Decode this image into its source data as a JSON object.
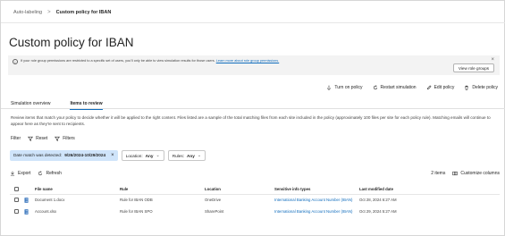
{
  "breadcrumb": {
    "parent": "Auto-labeling",
    "separator": ">",
    "current": "Custom policy for IBAN"
  },
  "page": {
    "title": "Custom policy for IBAN"
  },
  "banner": {
    "text": "If your role group permissions are restricted to a specific set of users, you'll only be able to view simulation results for those users.",
    "link": "Learn more about role group permissions.",
    "button": "View role groups",
    "close": "×"
  },
  "actions": [
    {
      "label": "Turn on policy",
      "icon": "turn-on-icon"
    },
    {
      "label": "Restart simulation",
      "icon": "restart-icon"
    },
    {
      "label": "Edit policy",
      "icon": "edit-icon"
    },
    {
      "label": "Delete policy",
      "icon": "delete-icon"
    }
  ],
  "tabs": [
    {
      "label": "Simulation overview",
      "active": false
    },
    {
      "label": "Items to review",
      "active": true
    }
  ],
  "description": "Review items that match your policy to decide whether it will be applied to the right content. Files listed are a sample of the total matching files from each site included in the policy (approximately 100 files per site for each policy rule). Matching emails will continue to appear here as they're sent to recipients.",
  "filterbar": {
    "filter": "Filter",
    "reset": "Reset",
    "filters": "Filters"
  },
  "chips": {
    "date_label": "Date match was detected:",
    "date_value": "9/26/2024-10/29/2024",
    "location_label": "Location:",
    "location_value": "Any",
    "rules_label": "Rules:",
    "rules_value": "Any"
  },
  "toolbar": {
    "export": "Export",
    "refresh": "Refresh",
    "count": "2 items",
    "customize": "Customize columns"
  },
  "table": {
    "headers": [
      "File name",
      "Rule",
      "Location",
      "Sensitive info types",
      "Last modified date"
    ],
    "rows": [
      {
        "name": "Document 1.docx",
        "rule": "Rule for IBAN ODB",
        "location": "OneDrive",
        "sit": "International Banking Account Number (IBAN)",
        "date": "Oct 28, 2024 6:27 AM"
      },
      {
        "name": "Account.xlsx",
        "rule": "Rule for IBAN SPO",
        "location": "SharePoint",
        "sit": "International Banking Account Number (IBAN)",
        "date": "Oct 29, 2024 5:27 AM"
      }
    ]
  }
}
